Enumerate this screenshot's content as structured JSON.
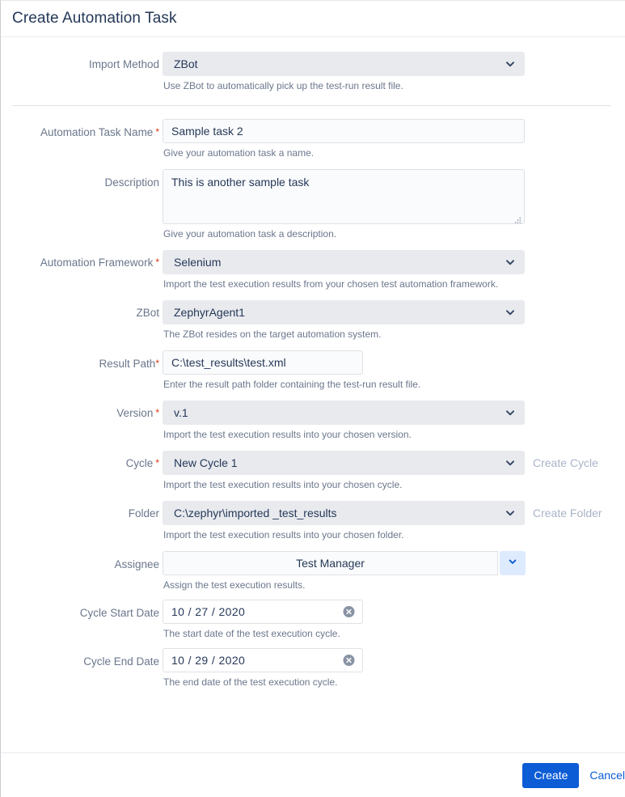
{
  "dialog": {
    "title": "Create Automation Task"
  },
  "import_method": {
    "label": "Import Method",
    "value": "ZBot",
    "hint": "Use ZBot to automatically pick up the test-run result file.",
    "icon": "chevron-down-icon"
  },
  "task_name": {
    "label": "Automation Task Name",
    "required": "*",
    "value": "Sample task 2",
    "hint": "Give your automation task a name."
  },
  "description": {
    "label": "Description",
    "value": "This is another sample task",
    "hint": "Give your automation task a description.",
    "resize_icon": "resize-grip-icon"
  },
  "framework": {
    "label": "Automation Framework",
    "required": "*",
    "value": "Selenium",
    "hint": "Import the test execution results from your chosen test automation framework.",
    "icon": "chevron-down-icon"
  },
  "zbot": {
    "label": "ZBot",
    "value": "ZephyrAgent1",
    "hint": "The ZBot resides on the target automation system.",
    "icon": "chevron-down-icon"
  },
  "result_path": {
    "label": "Result Path",
    "required": "*",
    "value": "C:\\test_results\\test.xml",
    "hint": "Enter the result path folder containing the test-run result file."
  },
  "version": {
    "label": "Version",
    "required": "*",
    "value": "v.1",
    "hint": "Import the test execution results into your chosen version.",
    "icon": "chevron-down-icon"
  },
  "cycle": {
    "label": "Cycle",
    "required": "*",
    "value": "New Cycle 1",
    "hint": "Import the test execution results into your chosen cycle.",
    "action_label": "Create Cycle",
    "icon": "chevron-down-icon"
  },
  "folder": {
    "label": "Folder",
    "value": "C:\\zephyr\\imported _test_results",
    "hint": "Import the test execution results into your chosen folder.",
    "action_label": "Create Folder",
    "icon": "chevron-down-icon"
  },
  "assignee": {
    "label": "Assignee",
    "value": "Test Manager",
    "hint": "Assign the test execution results.",
    "icon": "chevron-down-icon"
  },
  "cycle_start_date": {
    "label": "Cycle Start Date",
    "value": "10 / 27 / 2020",
    "hint": "The start date of the test execution cycle.",
    "icon": "clear-circle-icon"
  },
  "cycle_end_date": {
    "label": "Cycle End Date",
    "value": "10 / 29 / 2020",
    "hint": "The end date of the test execution cycle.",
    "icon": "clear-circle-icon"
  },
  "footer": {
    "create_label": "Create",
    "cancel_label": "Cancel"
  },
  "colors": {
    "primary_blue": "#0B5CD5",
    "required_red": "#DE350B",
    "field_gray": "#E8EAEE",
    "label_gray": "#6B778C",
    "title_navy": "#253858",
    "assignee_btn_blue": "#DEEBFF"
  }
}
